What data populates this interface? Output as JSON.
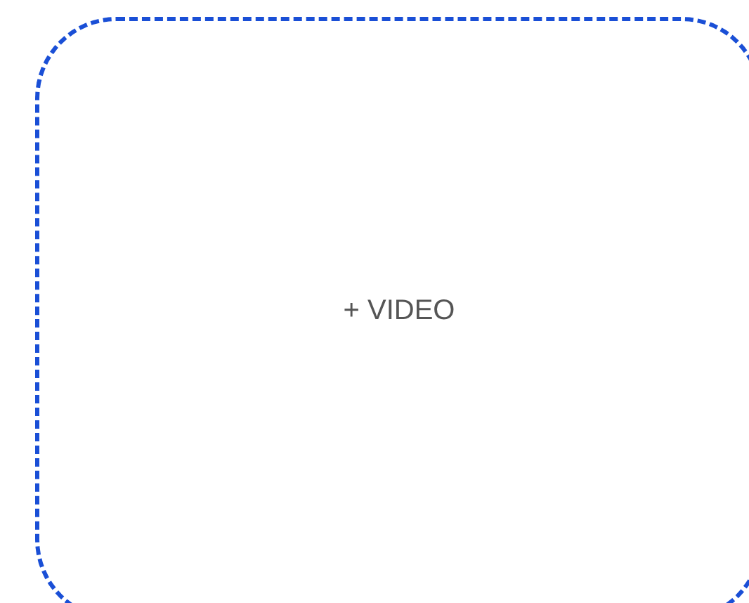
{
  "dropzone": {
    "label": "+ VIDEO"
  }
}
